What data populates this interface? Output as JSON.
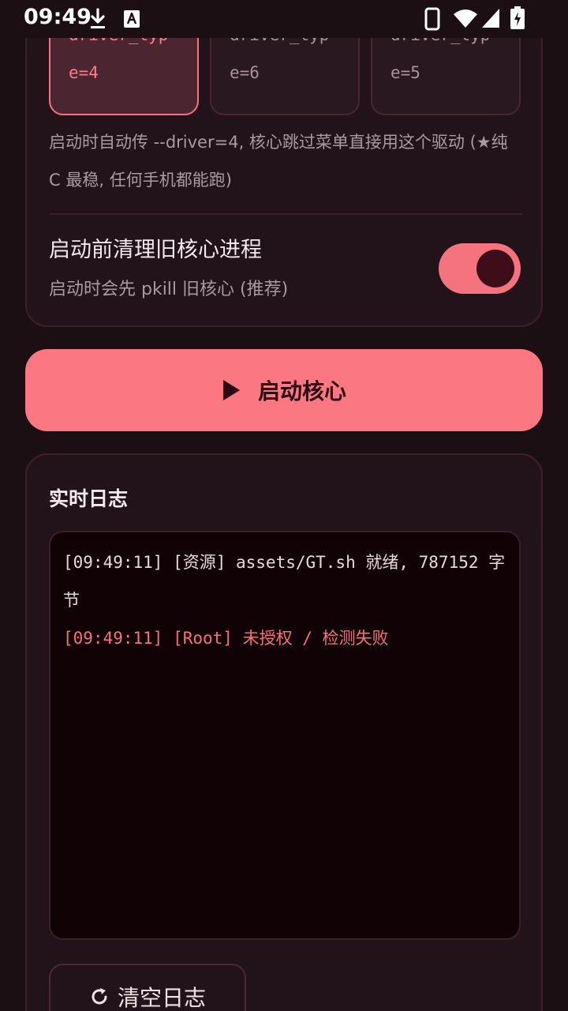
{
  "status_bar": {
    "time": "09:49",
    "icons": [
      "download-icon",
      "keyboard-a-icon",
      "phone-icon",
      "wifi-icon",
      "signal-icon",
      "battery-charging-icon"
    ]
  },
  "driver_section": {
    "options": [
      {
        "line1": "driver_typ",
        "line2": "e=4",
        "selected": true
      },
      {
        "line1": "driver_typ",
        "line2": "e=6",
        "selected": false
      },
      {
        "line1": "driver_typ",
        "line2": "e=5",
        "selected": false
      }
    ],
    "description": "启动时自动传 --driver=4, 核心跳过菜单直接用这个驱动 (★纯 C 最稳, 任何手机都能跑)"
  },
  "pkill_setting": {
    "title": "启动前清理旧核心进程",
    "subtitle": "启动时会先 pkill 旧核心 (推荐)",
    "enabled": true
  },
  "start_button": {
    "label": "启动核心",
    "icon": "play-icon"
  },
  "log_section": {
    "title": "实时日志",
    "lines": [
      {
        "text": "[09:49:11] [资源] assets/GT.sh 就绪, 787152 字节",
        "level": "info"
      },
      {
        "text": "[09:49:11] [Root] 未授权 / 检测失败",
        "level": "error"
      }
    ],
    "clear_label": "清空日志",
    "clear_icon": "refresh-icon"
  },
  "colors": {
    "accent": "#fb7782",
    "background": "#1c0f14",
    "error_text": "#f3717c"
  }
}
